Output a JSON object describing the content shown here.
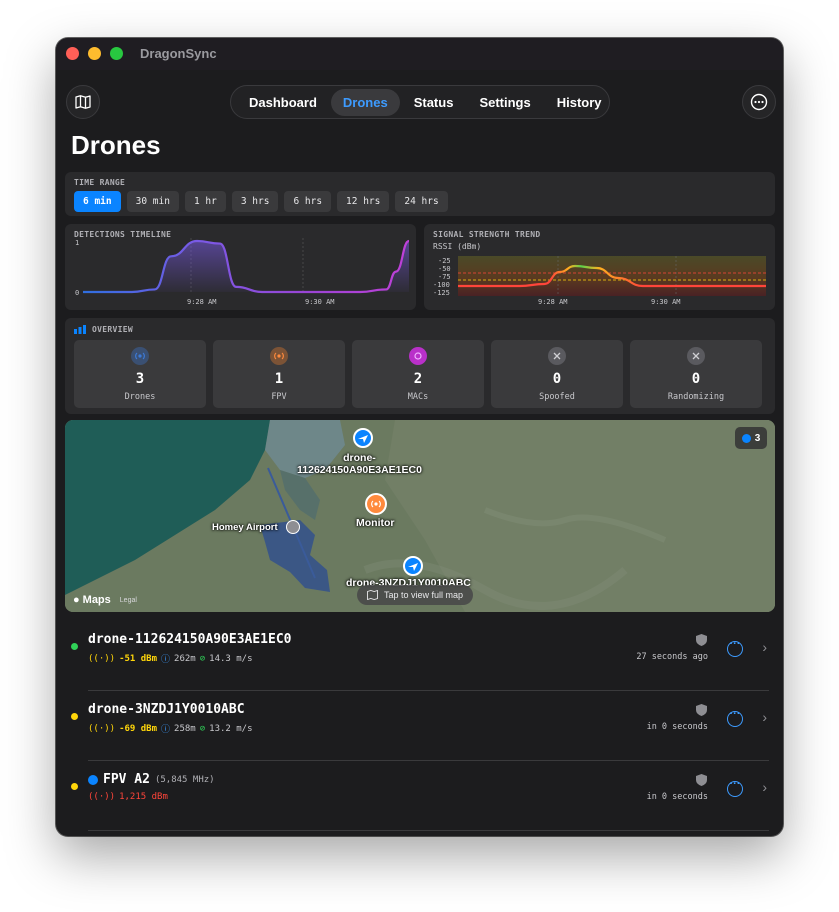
{
  "app": {
    "title": "DragonSync"
  },
  "nav": {
    "tabs": [
      "Dashboard",
      "Drones",
      "Status",
      "Settings",
      "History"
    ],
    "active": "Drones"
  },
  "page": {
    "title": "Drones"
  },
  "time_range": {
    "label": "TIME RANGE",
    "options": [
      "6 min",
      "30 min",
      "1 hr",
      "3 hrs",
      "6 hrs",
      "12 hrs",
      "24 hrs"
    ],
    "selected": "6 min"
  },
  "detections_timeline": {
    "label": "DETECTIONS TIMELINE",
    "y_ticks": [
      "1",
      "0"
    ],
    "x_ticks": [
      "9:28 AM",
      "9:30 AM"
    ]
  },
  "signal_trend": {
    "label": "SIGNAL STRENGTH TREND",
    "axis_label": "RSSI (dBm)",
    "y_ticks": [
      "-25",
      "-50",
      "-75",
      "-100",
      "-125"
    ],
    "x_ticks": [
      "9:28 AM",
      "9:30 AM"
    ]
  },
  "chart_data": [
    {
      "type": "area",
      "title": "DETECTIONS TIMELINE",
      "ylim": [
        0,
        1
      ],
      "x": [
        0,
        0.15,
        0.22,
        0.27,
        0.35,
        0.42,
        0.47,
        0.55,
        0.7,
        0.85,
        0.93,
        0.96,
        1.0
      ],
      "y": [
        0,
        0,
        0.05,
        0.7,
        1.0,
        0.95,
        0.1,
        0,
        0,
        0,
        0.05,
        0.4,
        1.0
      ],
      "x_ticks": [
        "9:28 AM",
        "9:30 AM"
      ]
    },
    {
      "type": "line",
      "title": "SIGNAL STRENGTH TREND",
      "ylabel": "RSSI (dBm)",
      "ylim": [
        -125,
        -25
      ],
      "x": [
        0,
        0.2,
        0.28,
        0.33,
        0.38,
        0.45,
        0.52,
        0.6,
        1.0
      ],
      "y": [
        -100,
        -100,
        -95,
        -65,
        -50,
        -55,
        -80,
        -100,
        -100
      ],
      "x_ticks": [
        "9:28 AM",
        "9:30 AM"
      ]
    }
  ],
  "overview": {
    "label": "OVERVIEW",
    "cards": [
      {
        "value": "3",
        "label": "Drones",
        "icon": "antenna-icon",
        "color": "#3d7bd9"
      },
      {
        "value": "1",
        "label": "FPV",
        "icon": "broadcast-icon",
        "color": "#e07a2e"
      },
      {
        "value": "2",
        "label": "MACs",
        "icon": "wifi-icon",
        "color": "#b930c9"
      },
      {
        "value": "0",
        "label": "Spoofed",
        "icon": "warning-icon",
        "color": "#6e6e73"
      },
      {
        "value": "0",
        "label": "Randomizing",
        "icon": "shuffle-icon",
        "color": "#6e6e73"
      }
    ]
  },
  "map": {
    "pins": [
      {
        "label": "drone-\n112624150A90E3AE1EC0"
      },
      {
        "label": "Monitor"
      },
      {
        "label": "drone-3NZDJ1Y0010ABC"
      },
      {
        "label": "Homey Airport"
      }
    ],
    "count_badge": "3",
    "brand": "Maps",
    "legal": "Legal",
    "hint": "Tap to view full map"
  },
  "drones": [
    {
      "name": "drone-112624150A90E3AE1EC0",
      "status_color": "#30d158",
      "rssi": "-51 dBm",
      "rssi_color": "#ffd60a",
      "altitude": "262m",
      "speed": "14.3 m/s",
      "time": "27 seconds ago"
    },
    {
      "name": "drone-3NZDJ1Y0010ABC",
      "status_color": "#ffd60a",
      "rssi": "-69 dBm",
      "rssi_color": "#ffd60a",
      "altitude": "258m",
      "speed": "13.2 m/s",
      "time": "in 0 seconds"
    },
    {
      "name": "FPV A2",
      "freq": "(5,845 MHz)",
      "status_color": "#ffd60a",
      "rssi": "1,215 dBm",
      "rssi_color": "#ff453a",
      "time": "in 0 seconds"
    }
  ]
}
